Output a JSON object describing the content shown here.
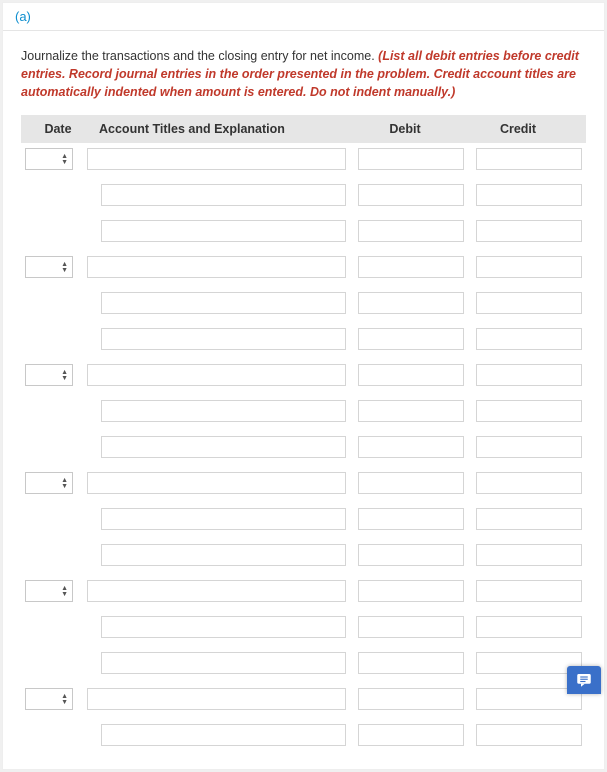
{
  "part_label": "(a)",
  "instructions": {
    "lead": "Journalize the transactions and the closing entry for net income. ",
    "emph": "(List all debit entries before credit entries. Record journal entries in the order presented in the problem. Credit account titles are automatically indented when amount is entered. Do not indent manually.)"
  },
  "columns": {
    "date": "Date",
    "account": "Account Titles and Explanation",
    "debit": "Debit",
    "credit": "Credit"
  },
  "groups": [
    {
      "date": "",
      "lines": [
        {
          "account": "",
          "debit": "",
          "credit": ""
        },
        {
          "account": "",
          "debit": "",
          "credit": ""
        },
        {
          "account": "",
          "debit": "",
          "credit": ""
        }
      ]
    },
    {
      "date": "",
      "lines": [
        {
          "account": "",
          "debit": "",
          "credit": ""
        },
        {
          "account": "",
          "debit": "",
          "credit": ""
        },
        {
          "account": "",
          "debit": "",
          "credit": ""
        }
      ]
    },
    {
      "date": "",
      "lines": [
        {
          "account": "",
          "debit": "",
          "credit": ""
        },
        {
          "account": "",
          "debit": "",
          "credit": ""
        },
        {
          "account": "",
          "debit": "",
          "credit": ""
        }
      ]
    },
    {
      "date": "",
      "lines": [
        {
          "account": "",
          "debit": "",
          "credit": ""
        },
        {
          "account": "",
          "debit": "",
          "credit": ""
        },
        {
          "account": "",
          "debit": "",
          "credit": ""
        }
      ]
    },
    {
      "date": "",
      "lines": [
        {
          "account": "",
          "debit": "",
          "credit": ""
        },
        {
          "account": "",
          "debit": "",
          "credit": ""
        },
        {
          "account": "",
          "debit": "",
          "credit": ""
        }
      ]
    },
    {
      "date": "",
      "lines": [
        {
          "account": "",
          "debit": "",
          "credit": ""
        },
        {
          "account": "",
          "debit": "",
          "credit": ""
        }
      ]
    }
  ]
}
